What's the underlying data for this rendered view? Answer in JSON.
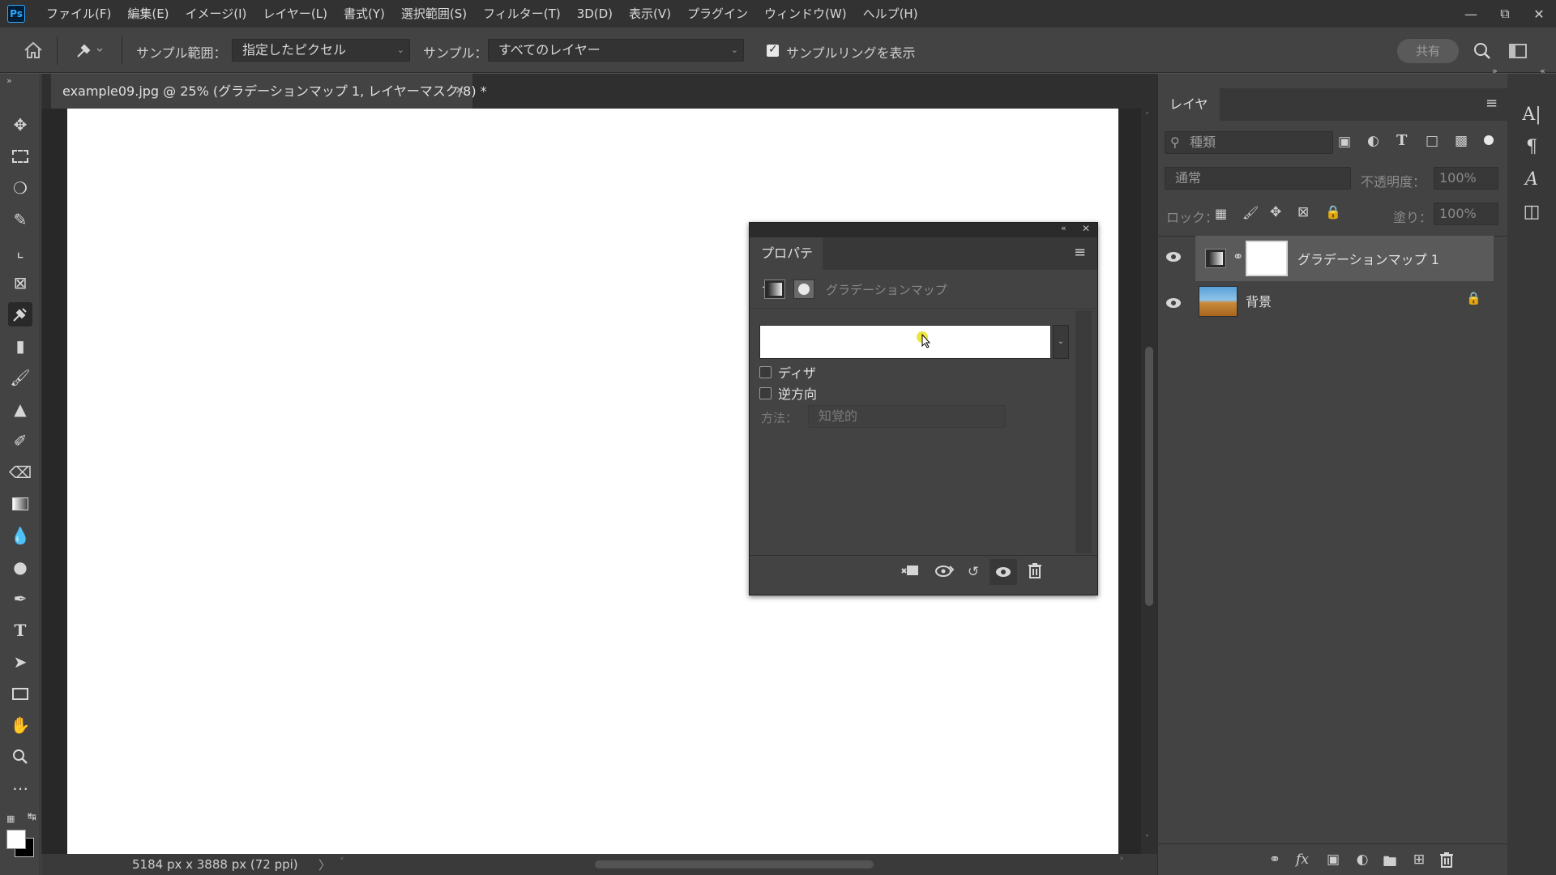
{
  "app": {
    "logo": "Ps"
  },
  "menu": [
    "ファイル(F)",
    "編集(E)",
    "イメージ(I)",
    "レイヤー(L)",
    "書式(Y)",
    "選択範囲(S)",
    "フィルター(T)",
    "3D(D)",
    "表示(V)",
    "プラグイン",
    "ウィンドウ(W)",
    "ヘルプ(H)"
  ],
  "options": {
    "sample_range_label": "サンプル範囲：",
    "sample_range_value": "指定したピクセル",
    "sample_label": "サンプル：",
    "sample_value": "すべてのレイヤー",
    "show_ring_label": "サンプルリングを表示",
    "show_ring_checked": true,
    "share_label": "共有"
  },
  "document": {
    "tab_title": "example09.jpg @ 25% (グラデーションマップ 1, レイヤーマスク/8) *",
    "status": "5184 px x 3888 px (72 ppi)"
  },
  "properties": {
    "tab_label": "プロパティ",
    "header_label": "グラデーションマップ",
    "dither_label": "ディザ",
    "dither_checked": false,
    "reverse_label": "逆方向",
    "reverse_checked": false,
    "method_label": "方法：",
    "method_value": "知覚的"
  },
  "layers": {
    "tab_label": "レイヤー",
    "filter_placeholder": "種類",
    "blend_mode": "通常",
    "opacity_label": "不透明度：",
    "opacity_value": "100%",
    "lock_label": "ロック：",
    "fill_label": "塗り：",
    "fill_value": "100%",
    "items": [
      {
        "name": "グラデーションマップ 1",
        "selected": true
      },
      {
        "name": "背景",
        "locked": true
      }
    ]
  },
  "colors": {
    "foreground": "#ffffff",
    "background": "#000000",
    "accent": "#31a8ff"
  }
}
